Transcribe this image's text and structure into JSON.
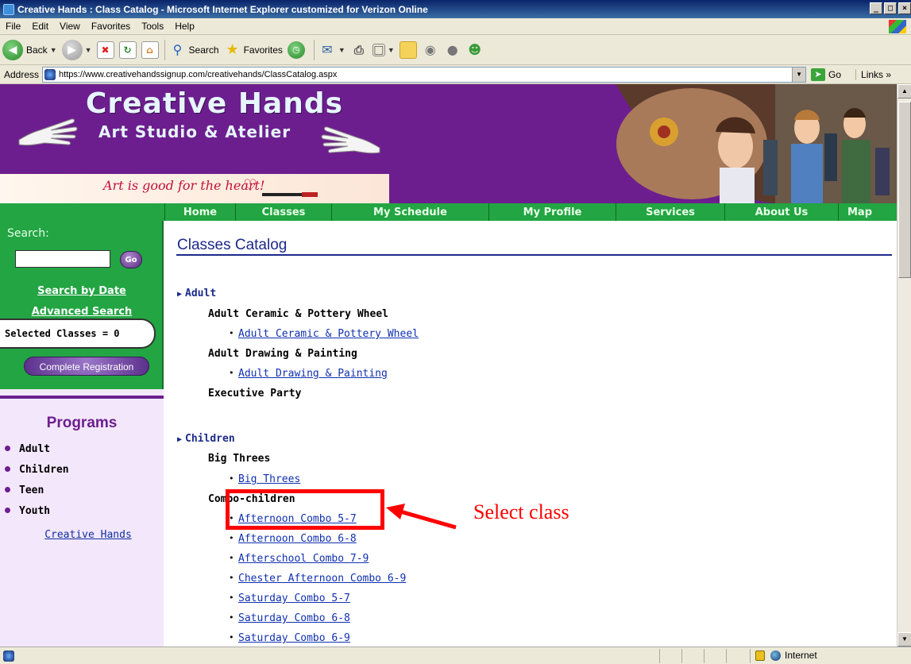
{
  "window": {
    "title": "Creative Hands : Class Catalog - Microsoft Internet Explorer customized for Verizon Online",
    "controls": {
      "min": "_",
      "max": "□",
      "close": "×"
    }
  },
  "menu": [
    "File",
    "Edit",
    "View",
    "Favorites",
    "Tools",
    "Help"
  ],
  "toolbar": {
    "back": "Back",
    "search": "Search",
    "favorites": "Favorites"
  },
  "address": {
    "label": "Address",
    "url": "https://www.creativehandssignup.com/creativehands/ClassCatalog.aspx",
    "go": "Go",
    "links": "Links"
  },
  "banner": {
    "title": "Creative Hands",
    "subtitle": "Art Studio & Atelier",
    "tagline": "Art is good for the heart!"
  },
  "nav": [
    "Home",
    "Classes",
    "My Schedule",
    "My Profile",
    "Services",
    "About Us",
    "Map"
  ],
  "sidebar": {
    "search_label": "Search:",
    "go": "Go",
    "search_by_date": "Search by Date",
    "advanced_search": "Advanced Search",
    "selected_classes": "Selected Classes = 0",
    "complete_registration": "Complete Registration",
    "programs_title": "Programs",
    "programs": [
      "Adult",
      "Children",
      "Teen",
      "Youth"
    ],
    "home_link": "Creative Hands"
  },
  "main": {
    "title": "Classes Catalog",
    "adult": {
      "label": "Adult",
      "sub1": "Adult Ceramic & Pottery Wheel",
      "sub1_links": [
        "Adult Ceramic & Pottery Wheel"
      ],
      "sub2": "Adult Drawing & Painting",
      "sub2_links": [
        "Adult Drawing & Painting"
      ],
      "sub3": "Executive Party"
    },
    "children": {
      "label": "Children",
      "sub1": "Big Threes",
      "sub1_links": [
        "Big Threes"
      ],
      "sub2": "Combo-children",
      "sub2_links": [
        "Afternoon Combo 5-7",
        "Afternoon Combo 6-8",
        "Afterschool Combo 7-9",
        "Chester Afternoon Combo 6-9",
        "Saturday Combo 5-7",
        "Saturday Combo 6-8",
        "Saturday Combo 6-9"
      ]
    }
  },
  "annotation": "Select class",
  "status": {
    "zone": "Internet"
  },
  "colors": {
    "brand_purple": "#6d1e8e",
    "nav_green": "#22a542",
    "highlight_red": "#ff0000"
  }
}
